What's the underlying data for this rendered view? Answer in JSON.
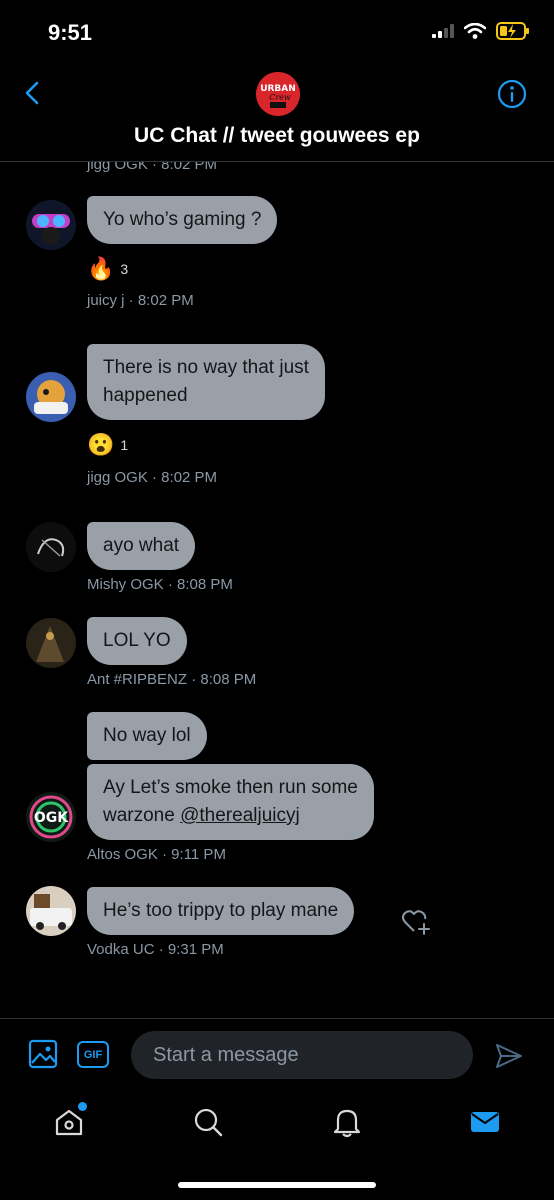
{
  "status": {
    "time": "9:51"
  },
  "header": {
    "group_title": "UC Chat //  tweet gouwees ep",
    "group_avatar_text_1": "URBAN",
    "group_avatar_text_2": "Crew",
    "back_icon": "chevron-left-icon",
    "info_icon": "info-icon"
  },
  "messages": [
    {
      "meta": "jigg OGK · 8:02 PM"
    },
    {
      "text": "Yo who’s gaming ?",
      "reaction_emoji": "🔥",
      "reaction_count": "3",
      "meta": "juicy j · 8:02 PM"
    },
    {
      "text_line1": "There is no way that just",
      "text_line2": "happened",
      "reaction_emoji": "😮",
      "reaction_count": "1",
      "meta": "jigg OGK · 8:02 PM"
    },
    {
      "text": "ayo what",
      "meta": "Mishy OGK · 8:08 PM"
    },
    {
      "text": "LOL YO",
      "meta": "Ant #RIPBENZ · 8:08 PM"
    },
    {
      "text": "No way lol"
    },
    {
      "text_line1": "Ay Let’s smoke then run some",
      "text_line2_prefix": "warzone ",
      "mention": "@therealjuicyj",
      "meta": "Altos OGK · 9:11 PM",
      "avatar_text": "OGK"
    },
    {
      "text": "He’s too trippy to play mane",
      "meta": "Vodka UC · 9:31 PM"
    }
  ],
  "composer": {
    "gif_label": "GIF",
    "placeholder": "Start a message"
  },
  "tabs": [
    {
      "icon": "home-icon"
    },
    {
      "icon": "search-icon"
    },
    {
      "icon": "bell-icon"
    },
    {
      "icon": "mail-icon"
    }
  ],
  "colors": {
    "accent": "#1d9bf0",
    "bubble": "#9aa0a8",
    "background": "#000000",
    "meta_text": "#8b98a5"
  }
}
